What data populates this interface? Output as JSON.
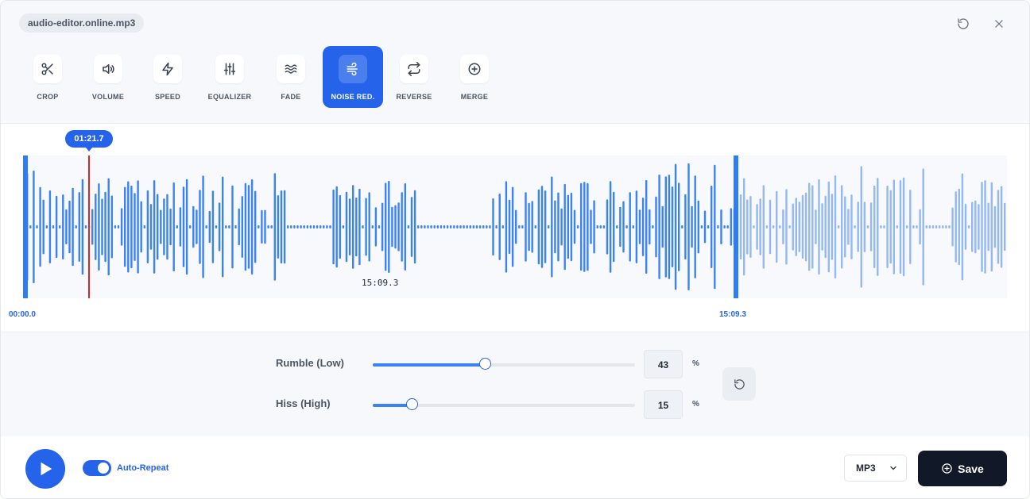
{
  "file": {
    "name": "audio-editor.online.mp3"
  },
  "header": {
    "icons": [
      "undo-icon",
      "close-icon"
    ]
  },
  "tools": [
    {
      "id": "crop",
      "label": "CROP",
      "icon": "scissors-icon",
      "active": false
    },
    {
      "id": "volume",
      "label": "VOLUME",
      "icon": "speaker-icon",
      "active": false
    },
    {
      "id": "speed",
      "label": "SPEED",
      "icon": "lightning-icon",
      "active": false
    },
    {
      "id": "equalizer",
      "label": "EQUALIZER",
      "icon": "sliders-icon",
      "active": false
    },
    {
      "id": "fade",
      "label": "FADE",
      "icon": "waves-icon",
      "active": false
    },
    {
      "id": "noise",
      "label": "NOISE RED.",
      "icon": "wind-icon",
      "active": true
    },
    {
      "id": "reverse",
      "label": "REVERSE",
      "icon": "repeat-arrows-icon",
      "active": false
    },
    {
      "id": "merge",
      "label": "MERGE",
      "icon": "plus-circle-icon",
      "active": false
    }
  ],
  "waveform": {
    "playhead": "01:21.7",
    "start": "00:00.0",
    "end": "15:09.3",
    "hover_time": "15:09.3"
  },
  "noise_reduction": {
    "rumble": {
      "label": "Rumble (Low)",
      "value": 43,
      "unit": "%"
    },
    "hiss": {
      "label": "Hiss (High)",
      "value": 15,
      "unit": "%"
    }
  },
  "footer": {
    "auto_repeat": {
      "label": "Auto-Repeat",
      "enabled": true
    },
    "format": "MP3",
    "save_label": "Save"
  },
  "colors": {
    "accent": "#2563eb",
    "wave": "#3b82f6",
    "wave_faded": "#93b8f4",
    "playhead": "#dc2626",
    "dark": "#111827"
  }
}
